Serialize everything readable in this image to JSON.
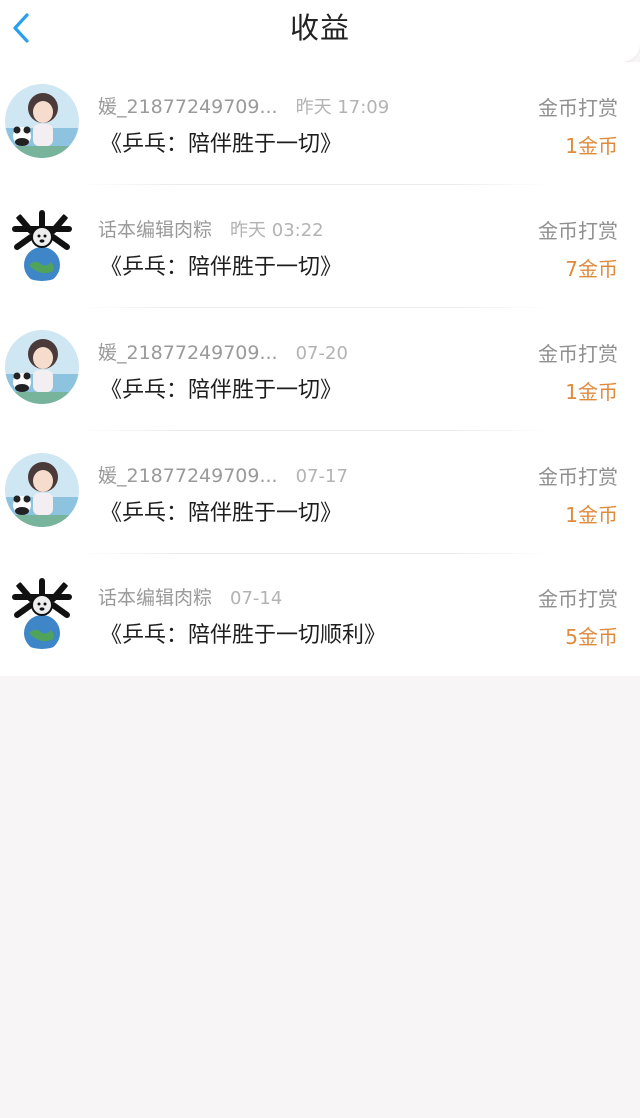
{
  "header": {
    "title": "收益",
    "back_icon": "chevron-left-icon",
    "accent": "#2a9ff0"
  },
  "colors": {
    "amount": "#e08a3c"
  },
  "items": [
    {
      "user": "媛_21877249709...",
      "time": "昨天 17:09",
      "book": "《乒乓：陪伴胜于一切》",
      "type": "金币打赏",
      "amount": "1金币",
      "avatar": "girl-panda-avatar"
    },
    {
      "user": "话本编辑肉粽",
      "time": "昨天 03:22",
      "book": "《乒乓：陪伴胜于一切》",
      "type": "金币打赏",
      "amount": "7金币",
      "avatar": "dog-earth-avatar"
    },
    {
      "user": "媛_21877249709...",
      "time": "07-20",
      "book": "《乒乓：陪伴胜于一切》",
      "type": "金币打赏",
      "amount": "1金币",
      "avatar": "girl-panda-avatar"
    },
    {
      "user": "媛_21877249709...",
      "time": "07-17",
      "book": "《乒乓：陪伴胜于一切》",
      "type": "金币打赏",
      "amount": "1金币",
      "avatar": "girl-panda-avatar"
    },
    {
      "user": "话本编辑肉粽",
      "time": "07-14",
      "book": "《乒乓：陪伴胜于一切顺利》",
      "type": "金币打赏",
      "amount": "5金币",
      "avatar": "dog-earth-avatar"
    }
  ]
}
